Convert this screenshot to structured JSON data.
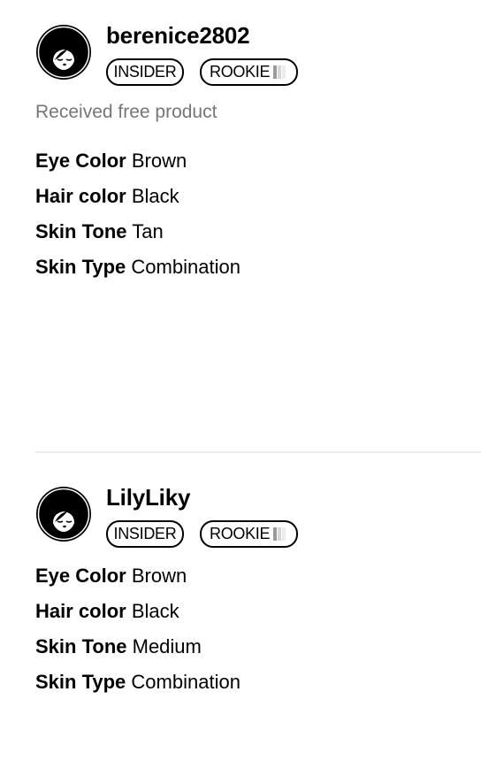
{
  "reviews": [
    {
      "username": "berenice2802",
      "badges": [
        "INSIDER",
        "ROOKIE"
      ],
      "incentive": "Received free product",
      "traits": [
        {
          "label": "Eye Color",
          "value": "Brown"
        },
        {
          "label": "Hair color",
          "value": "Black"
        },
        {
          "label": "Skin Tone",
          "value": "Tan"
        },
        {
          "label": "Skin Type",
          "value": "Combination"
        }
      ]
    },
    {
      "username": "LilyLiky",
      "badges": [
        "INSIDER",
        "ROOKIE"
      ],
      "traits": [
        {
          "label": "Eye Color",
          "value": "Brown"
        },
        {
          "label": "Hair color",
          "value": "Black"
        },
        {
          "label": "Skin Tone",
          "value": "Medium"
        },
        {
          "label": "Skin Type",
          "value": "Combination"
        }
      ]
    }
  ],
  "icons": {
    "avatar": "default-user-avatar-icon",
    "rookie_meter": "rank-meter-icon"
  }
}
